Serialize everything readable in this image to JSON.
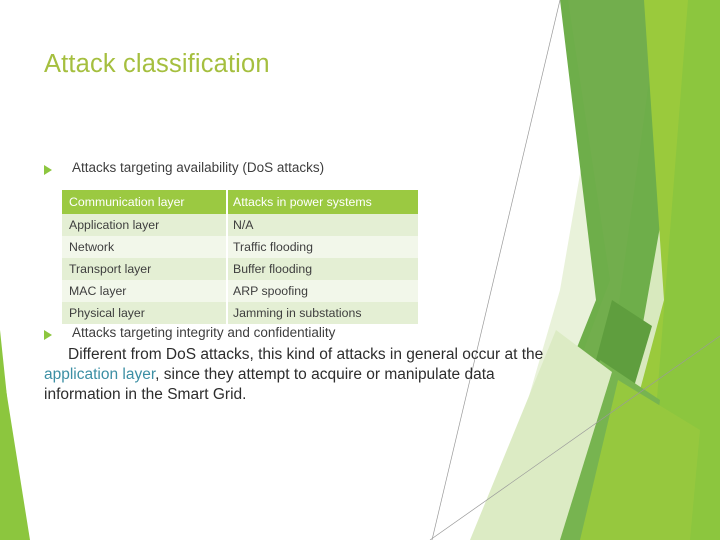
{
  "slide": {
    "title": "Attack classification",
    "theme_colors": {
      "title_green": "#A5BF3F",
      "bullet_green": "#8DC63F",
      "table_header_green": "#9BC941",
      "table_row_light": "#E4EFD4",
      "table_row_lighter": "#F2F7EA",
      "highlight_teal": "#3C8FA4",
      "deco_dark_green": "#6EAE4A",
      "deco_lime_green": "#8CC63E",
      "deco_bright_green": "#9ACA3C",
      "deco_pale_green": "#D8E9BE",
      "deco_very_pale_green": "#E9F2DA",
      "deco_line_gray": "#9A9A9A",
      "body_text": "#3E3E3E"
    },
    "bullets": [
      {
        "marker": "triangle-right",
        "text": "Attacks targeting availability (DoS attacks)"
      },
      {
        "marker": "triangle-right",
        "text": "Attacks targeting integrity and confidentiality"
      }
    ],
    "table": {
      "headers": [
        "Communication layer",
        "Attacks in power systems"
      ],
      "rows": [
        [
          "Application layer",
          "N/A"
        ],
        [
          "Network",
          "Traffic flooding"
        ],
        [
          "Transport layer",
          "Buffer flooding"
        ],
        [
          "MAC layer",
          "ARP spoofing"
        ],
        [
          "Physical layer",
          "Jamming in substations"
        ]
      ]
    },
    "paragraph": {
      "part1": "Different from DoS attacks, this kind of attacks in general occur at the ",
      "highlight": "application layer",
      "part2": ", since they attempt to acquire or manipulate data information in the Smart Grid."
    }
  }
}
